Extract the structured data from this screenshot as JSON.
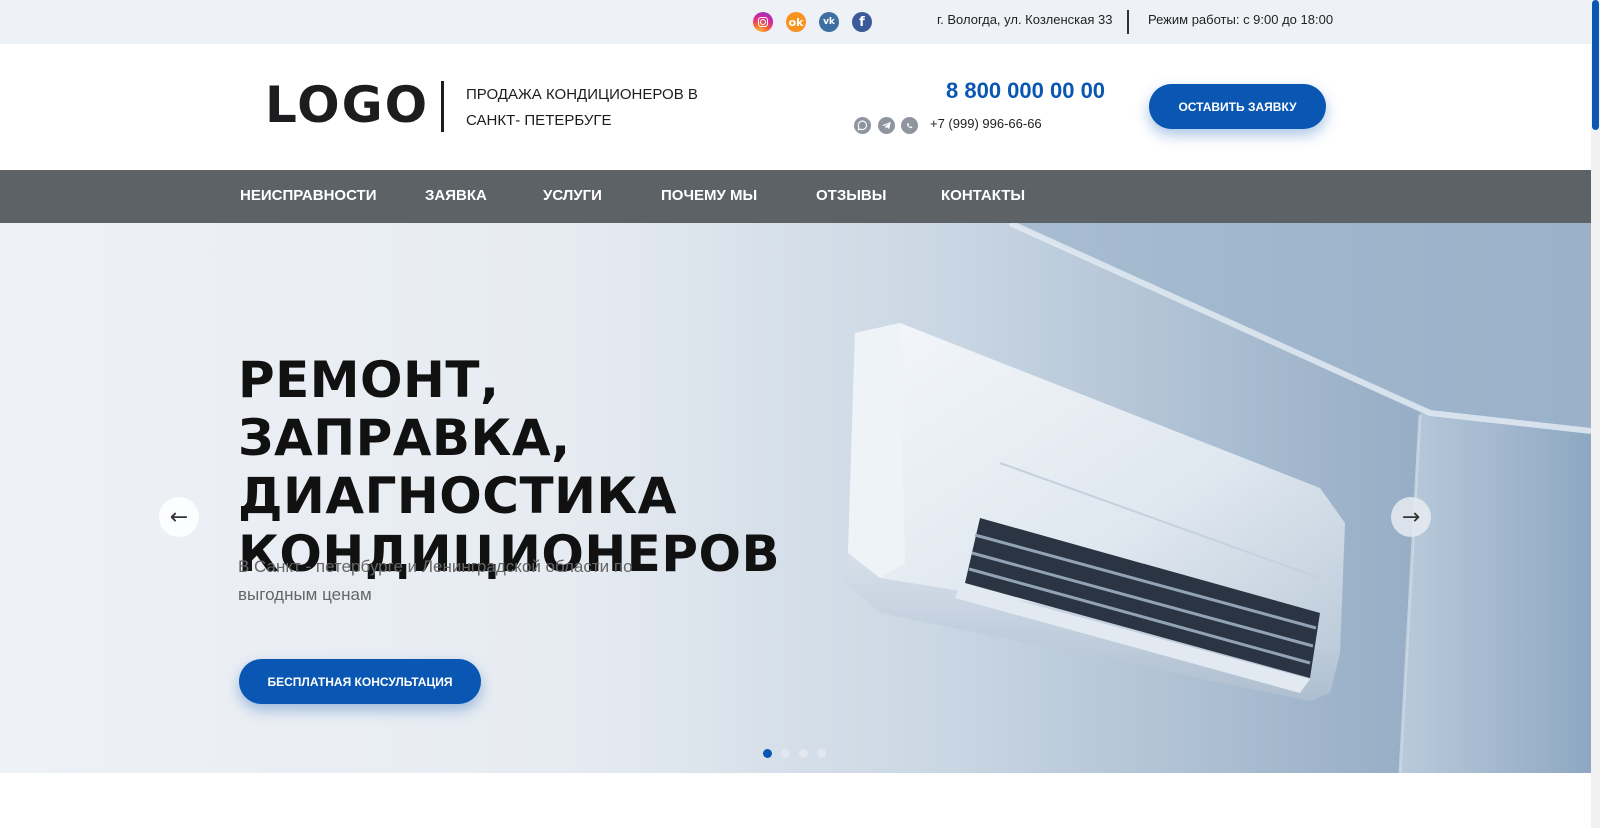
{
  "topbar": {
    "social": [
      {
        "name": "instagram",
        "icon": "instagram-icon",
        "glyph": ""
      },
      {
        "name": "odnoklassniki",
        "icon": "odnoklassniki-icon",
        "glyph": "ok"
      },
      {
        "name": "vkontakte",
        "icon": "vk-icon",
        "glyph": "vk"
      },
      {
        "name": "facebook",
        "icon": "facebook-icon",
        "glyph": "f"
      }
    ],
    "address": "г. Вологда, ул. Козленская 33",
    "hours": "Режим работы: с 9:00 до 18:00"
  },
  "header": {
    "logo": "LOGO",
    "tagline": "ПРОДАЖА КОНДИЦИОНЕРОВ В САНКТ- ПЕТЕРБУГЕ",
    "phone_main": "8 800 000 00 00",
    "messengers": [
      "viber-icon",
      "telegram-icon",
      "whatsapp-icon"
    ],
    "phone_alt": "+7 (999) 996-66-66",
    "order_button": "ОСТАВИТЬ ЗАЯВКУ"
  },
  "nav": {
    "items": [
      "НЕИСПРАВНОСТИ",
      "ЗАЯВКА",
      "УСЛУГИ",
      "ПОЧЕМУ МЫ",
      "ОТЗЫВЫ",
      "КОНТАКТЫ"
    ]
  },
  "hero": {
    "title": "РЕМОНТ, ЗАПРАВКА, ДИАГНОСТИКА КОНДИЦИОНЕРОВ",
    "subtitle": "В Санкт - петербурге и Ленинградской области по выгодным ценам",
    "cta": "БЕСПЛАТНАЯ КОНСУЛЬТАЦИЯ",
    "prev_glyph": "←",
    "next_glyph": "→",
    "slides_total": 4,
    "active_slide": 1
  },
  "colors": {
    "accent": "#0a57b3",
    "nav_bg": "#5d6267",
    "topbar_bg": "#eef1f6"
  }
}
